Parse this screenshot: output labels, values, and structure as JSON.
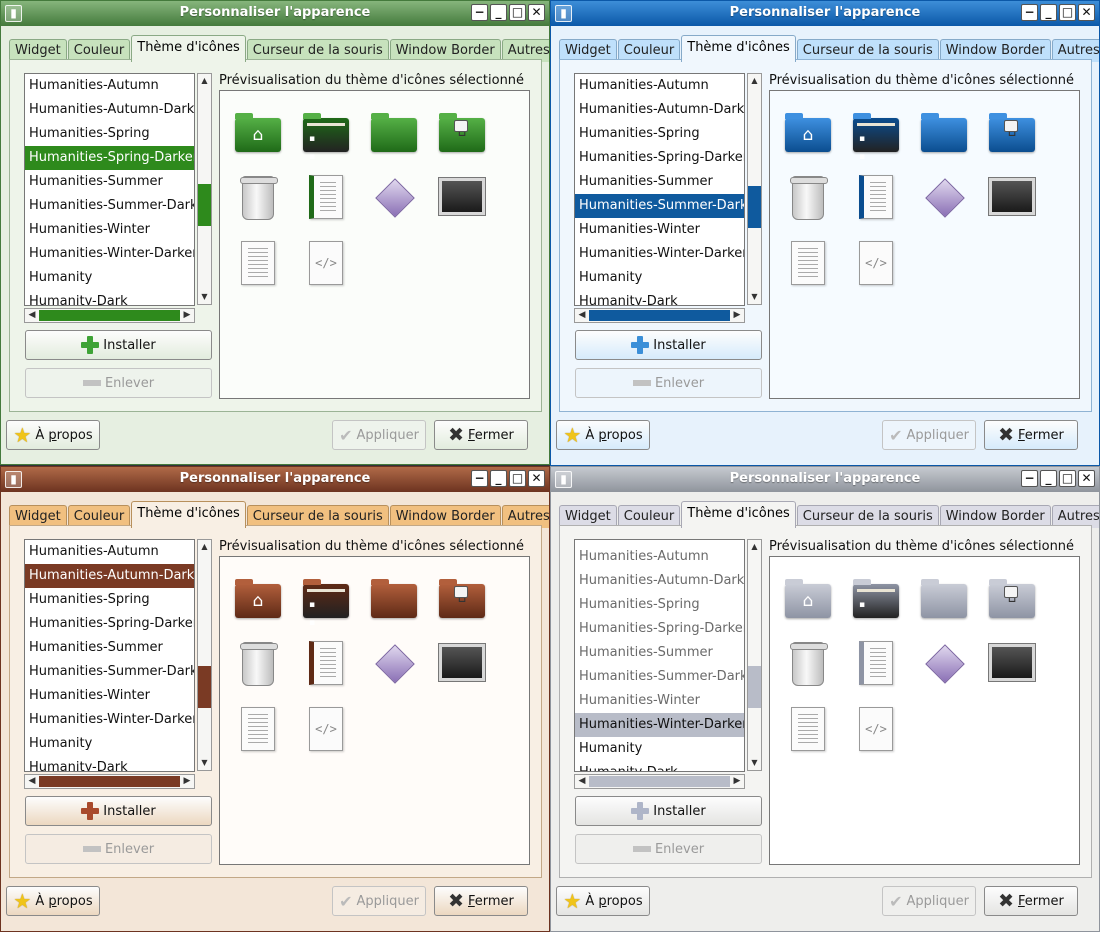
{
  "window": {
    "title": "Personnaliser l'apparence",
    "tabs": [
      "Widget",
      "Couleur",
      "Thème d'icônes",
      "Curseur de la souris",
      "Window Border",
      "Autres"
    ],
    "active_tab": "Thème d'icônes",
    "theme_list": [
      "Humanities-Autumn",
      "Humanities-Autumn-Darker",
      "Humanities-Spring",
      "Humanities-Spring-Darker",
      "Humanities-Summer",
      "Humanities-Summer-Darker",
      "Humanities-Winter",
      "Humanities-Winter-Darker",
      "Humanity",
      "Humanity-Dark"
    ],
    "preview_label": "Prévisualisation du thème d'icônes sélectionné",
    "install_label": "Installer",
    "remove_label": "Enlever",
    "about_prefix": "À ",
    "about_underlined": "p",
    "about_rest": "ropos",
    "apply_label": "Appliquer",
    "close_underlined": "F",
    "close_rest": "ermer"
  },
  "variants": [
    {
      "theme": "green",
      "selected": "Humanities-Spring-Darker",
      "accent": "#2e8a1c"
    },
    {
      "theme": "blue",
      "selected": "Humanities-Summer-Darker",
      "accent": "#0f5a9e"
    },
    {
      "theme": "brown",
      "selected": "Humanities-Autumn-Darker",
      "accent": "#7a3a24"
    },
    {
      "theme": "grey",
      "selected": "Humanities-Winter-Darker",
      "accent": "#b8bcc8"
    }
  ],
  "icons": [
    "home-folder-icon",
    "desktop-folder-icon",
    "folder-icon",
    "remote-folder-icon",
    "trash-icon",
    "document-icon",
    "image-file-icon",
    "terminal-icon",
    "text-file-icon",
    "source-code-icon"
  ]
}
